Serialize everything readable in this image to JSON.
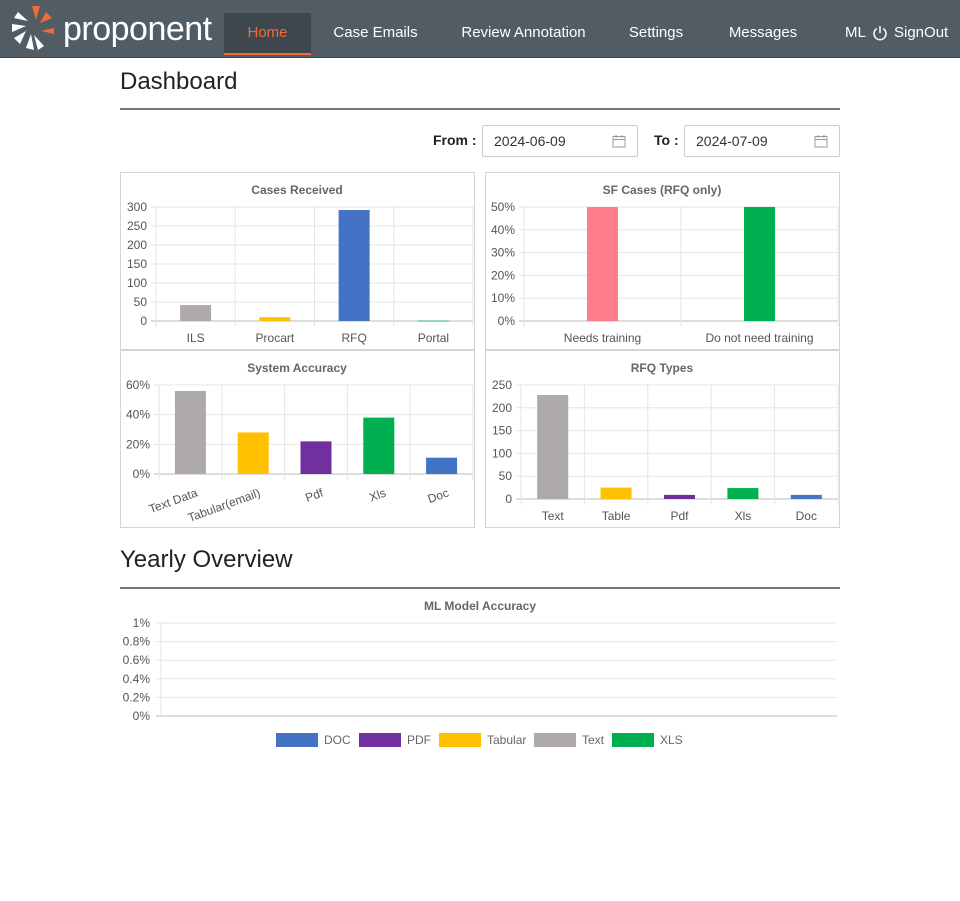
{
  "nav": {
    "logo_text": "proponent",
    "items": [
      {
        "label": "Home",
        "active": true
      },
      {
        "label": "Case Emails"
      },
      {
        "label": "Review Annotation"
      },
      {
        "label": "Settings"
      },
      {
        "label": "Messages"
      },
      {
        "label": "ML Models"
      }
    ],
    "signout_label": "SignOut"
  },
  "dashboard": {
    "title": "Dashboard",
    "from_label": "From",
    "to_label": "To",
    "from_value": "2024-06-09",
    "to_value": "2024-07-09"
  },
  "yearly": {
    "title": "Yearly Overview"
  },
  "colors": {
    "blue": "#4472c4",
    "purple": "#7030a0",
    "yellow": "#ffc000",
    "gray": "#aeaaaa",
    "green": "#00b050",
    "pink": "#ff7c8d",
    "orange": "#f26c33"
  },
  "chart_data": [
    {
      "id": "cases_received",
      "type": "bar",
      "title": "Cases Received",
      "categories": [
        "ILS",
        "Procart",
        "RFQ",
        "Portal"
      ],
      "values": [
        42,
        10,
        292,
        1
      ],
      "colors": [
        "#aeaaaa",
        "#ffc000",
        "#4472c4",
        "#00b050"
      ],
      "ylim": [
        0,
        300
      ],
      "yticks": [
        "0",
        "50",
        "100",
        "150",
        "200",
        "250",
        "300"
      ],
      "grid": true
    },
    {
      "id": "sf_cases",
      "type": "bar",
      "title": "SF Cases (RFQ only)",
      "categories": [
        "Needs training",
        "Do not need training"
      ],
      "values": [
        50,
        50
      ],
      "colors": [
        "#ff7c8d",
        "#00b050"
      ],
      "ylim": [
        0,
        50
      ],
      "yticks": [
        "0%",
        "10%",
        "20%",
        "30%",
        "40%",
        "50%"
      ],
      "grid": true
    },
    {
      "id": "system_accuracy",
      "type": "bar",
      "title": "System  Accuracy",
      "categories": [
        "Text Data",
        "Tabular(email)",
        "Pdf",
        "Xls",
        "Doc"
      ],
      "values": [
        56,
        28,
        22,
        38,
        11
      ],
      "colors": [
        "#aeaaaa",
        "#ffc000",
        "#7030a0",
        "#00b050",
        "#4472c4"
      ],
      "ylim": [
        0,
        60
      ],
      "yticks": [
        "0%",
        "20%",
        "40%",
        "60%"
      ],
      "grid": true
    },
    {
      "id": "rfq_types",
      "type": "bar",
      "title": "RFQ Types",
      "categories": [
        "Text",
        "Table",
        "Pdf",
        "Xls",
        "Doc"
      ],
      "values": [
        228,
        25,
        9,
        24,
        9
      ],
      "colors": [
        "#aeaaaa",
        "#ffc000",
        "#7030a0",
        "#00b050",
        "#4472c4"
      ],
      "ylim": [
        0,
        250
      ],
      "yticks": [
        "0",
        "50",
        "100",
        "150",
        "200",
        "250"
      ],
      "grid": true
    },
    {
      "id": "ml_model_accuracy",
      "type": "line",
      "title": "ML Model Accuracy",
      "series": [
        {
          "name": "DOC",
          "values": [],
          "color": "#4472c4"
        },
        {
          "name": "PDF",
          "values": [],
          "color": "#7030a0"
        },
        {
          "name": "Tabular",
          "values": [],
          "color": "#ffc000"
        },
        {
          "name": "Text",
          "values": [],
          "color": "#aeaaaa"
        },
        {
          "name": "XLS",
          "values": [],
          "color": "#00b050"
        }
      ],
      "ylim": [
        0,
        1
      ],
      "yticks": [
        "0%",
        "0.2%",
        "0.4%",
        "0.6%",
        "0.8%",
        "1%"
      ],
      "grid": true,
      "legend": "bottom"
    }
  ]
}
